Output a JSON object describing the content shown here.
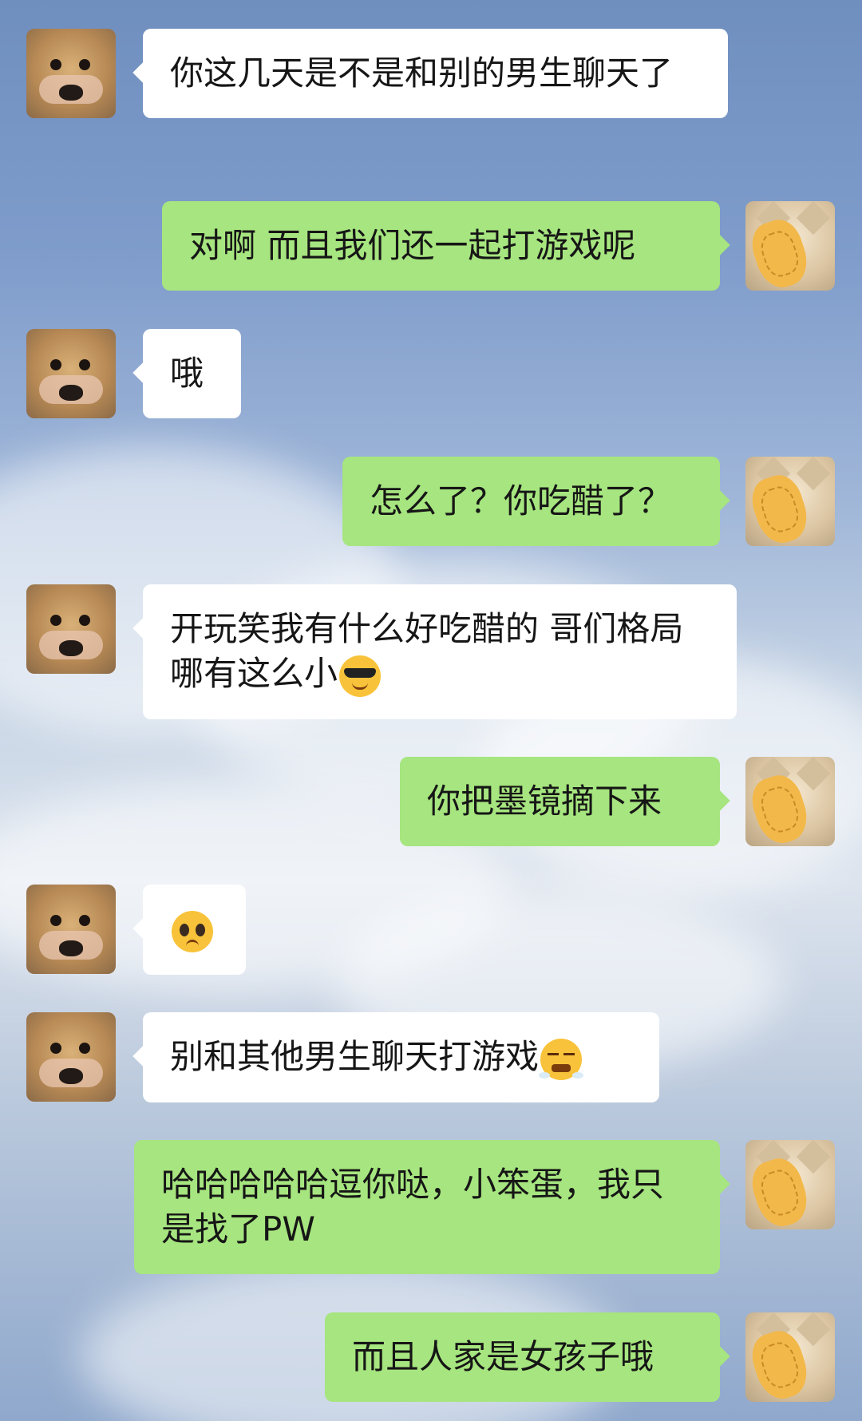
{
  "messages": [
    {
      "side": "in",
      "text": "你这几天是不是和别的男生聊天了"
    },
    {
      "side": "out",
      "text": "对啊 而且我们还一起打游戏呢"
    },
    {
      "side": "in",
      "text": "哦"
    },
    {
      "side": "out",
      "text": "怎么了？你吃醋了？"
    },
    {
      "side": "in",
      "text": "开玩笑我有什么好吃醋的 哥们格局哪有这么小",
      "emoji": "smiling-face-with-sunglasses-emoji"
    },
    {
      "side": "out",
      "text": "你把墨镜摘下来"
    },
    {
      "side": "in",
      "text": "",
      "emoji": "pleading-face-emoji"
    },
    {
      "side": "in",
      "text": "别和其他男生聊天打游戏",
      "emoji": "face-with-steam-from-nose-emoji"
    },
    {
      "side": "out",
      "text": "哈哈哈哈哈逗你哒，小笨蛋，我只是找了PW"
    },
    {
      "side": "out",
      "text": "而且人家是女孩子哦"
    }
  ]
}
